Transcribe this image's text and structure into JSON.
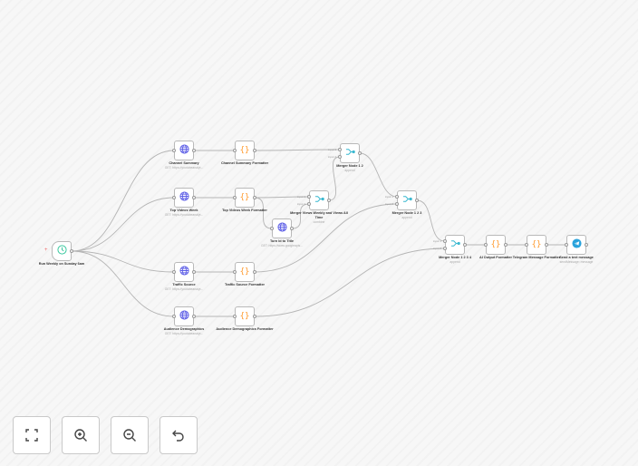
{
  "nodes": [
    {
      "id": "trigger",
      "label": "Run Weekly on Sunday 6am",
      "subtitle": "",
      "icon": "clock-icon",
      "type": "trigger"
    },
    {
      "id": "cs",
      "label": "Channel Summary",
      "subtitle": "GET: https://youtubeanalyt...",
      "icon": "globe-icon"
    },
    {
      "id": "csf",
      "label": "Channel Summary Formatter",
      "subtitle": "",
      "icon": "braces-icon"
    },
    {
      "id": "tv",
      "label": "Top Videos Week",
      "subtitle": "GET: https://youtubeanalyt...",
      "icon": "globe-icon"
    },
    {
      "id": "tvf",
      "label": "Top Videos Week Formatter",
      "subtitle": "",
      "icon": "braces-icon"
    },
    {
      "id": "tit",
      "label": "Turn Id to Title",
      "subtitle": "GET: https://www.googleapis...",
      "icon": "globe-icon"
    },
    {
      "id": "mv",
      "label": "Merger Views Weekly and Views All Time",
      "subtitle": "combine",
      "icon": "merge-icon"
    },
    {
      "id": "m12",
      "label": "Merger Node 1 2",
      "subtitle": "append",
      "icon": "merge-icon"
    },
    {
      "id": "m123",
      "label": "Merger Node 1 2 3",
      "subtitle": "append",
      "icon": "merge-icon"
    },
    {
      "id": "ts",
      "label": "Traffic Source",
      "subtitle": "GET: https://youtubeanalyt...",
      "icon": "globe-icon"
    },
    {
      "id": "tsf",
      "label": "Traffic Source Formatter",
      "subtitle": "",
      "icon": "braces-icon"
    },
    {
      "id": "ad",
      "label": "Audience Demographics",
      "subtitle": "GET: https://youtubeanalyt...",
      "icon": "globe-icon"
    },
    {
      "id": "adf",
      "label": "Audience Demographics Formatter",
      "subtitle": "",
      "icon": "braces-icon"
    },
    {
      "id": "m1234",
      "label": "Merger Node 1 2 3 4",
      "subtitle": "append",
      "icon": "merge-icon"
    },
    {
      "id": "ai",
      "label": "AI Output Formatter",
      "subtitle": "",
      "icon": "braces-icon"
    },
    {
      "id": "tg",
      "label": "Telegram Message Formatter",
      "subtitle": "",
      "icon": "braces-icon"
    },
    {
      "id": "send",
      "label": "Send a text message",
      "subtitle": "sendMessage: message",
      "icon": "telegram-icon"
    }
  ],
  "connections": [
    [
      "trigger",
      "cs"
    ],
    [
      "trigger",
      "tv"
    ],
    [
      "trigger",
      "ts"
    ],
    [
      "trigger",
      "ad"
    ],
    [
      "cs",
      "csf"
    ],
    [
      "tv",
      "tvf"
    ],
    [
      "ts",
      "tsf"
    ],
    [
      "ad",
      "adf"
    ],
    [
      "csf",
      "m12"
    ],
    [
      "tvf",
      "mv"
    ],
    [
      "tvf",
      "tit"
    ],
    [
      "tit",
      "mv"
    ],
    [
      "mv",
      "m12"
    ],
    [
      "m12",
      "m123"
    ],
    [
      "tsf",
      "m123"
    ],
    [
      "m123",
      "m1234"
    ],
    [
      "adf",
      "m1234"
    ],
    [
      "m1234",
      "ai"
    ],
    [
      "ai",
      "tg"
    ],
    [
      "tg",
      "send"
    ]
  ],
  "input_labels": [
    "input 1",
    "input 2"
  ],
  "controls": [
    {
      "name": "fit-view-button",
      "icon": "fit-view-icon"
    },
    {
      "name": "zoom-in-button",
      "icon": "zoom-in-icon"
    },
    {
      "name": "zoom-out-button",
      "icon": "zoom-out-icon"
    },
    {
      "name": "undo-button",
      "icon": "undo-icon"
    }
  ],
  "colors": {
    "globe": "#5b5ce6",
    "braces": "#ff9a2e",
    "merge": "#3ab8d0",
    "clock": "#3cc9a0",
    "telegram": "#2aa3dc",
    "edge": "#b5b5b5"
  }
}
